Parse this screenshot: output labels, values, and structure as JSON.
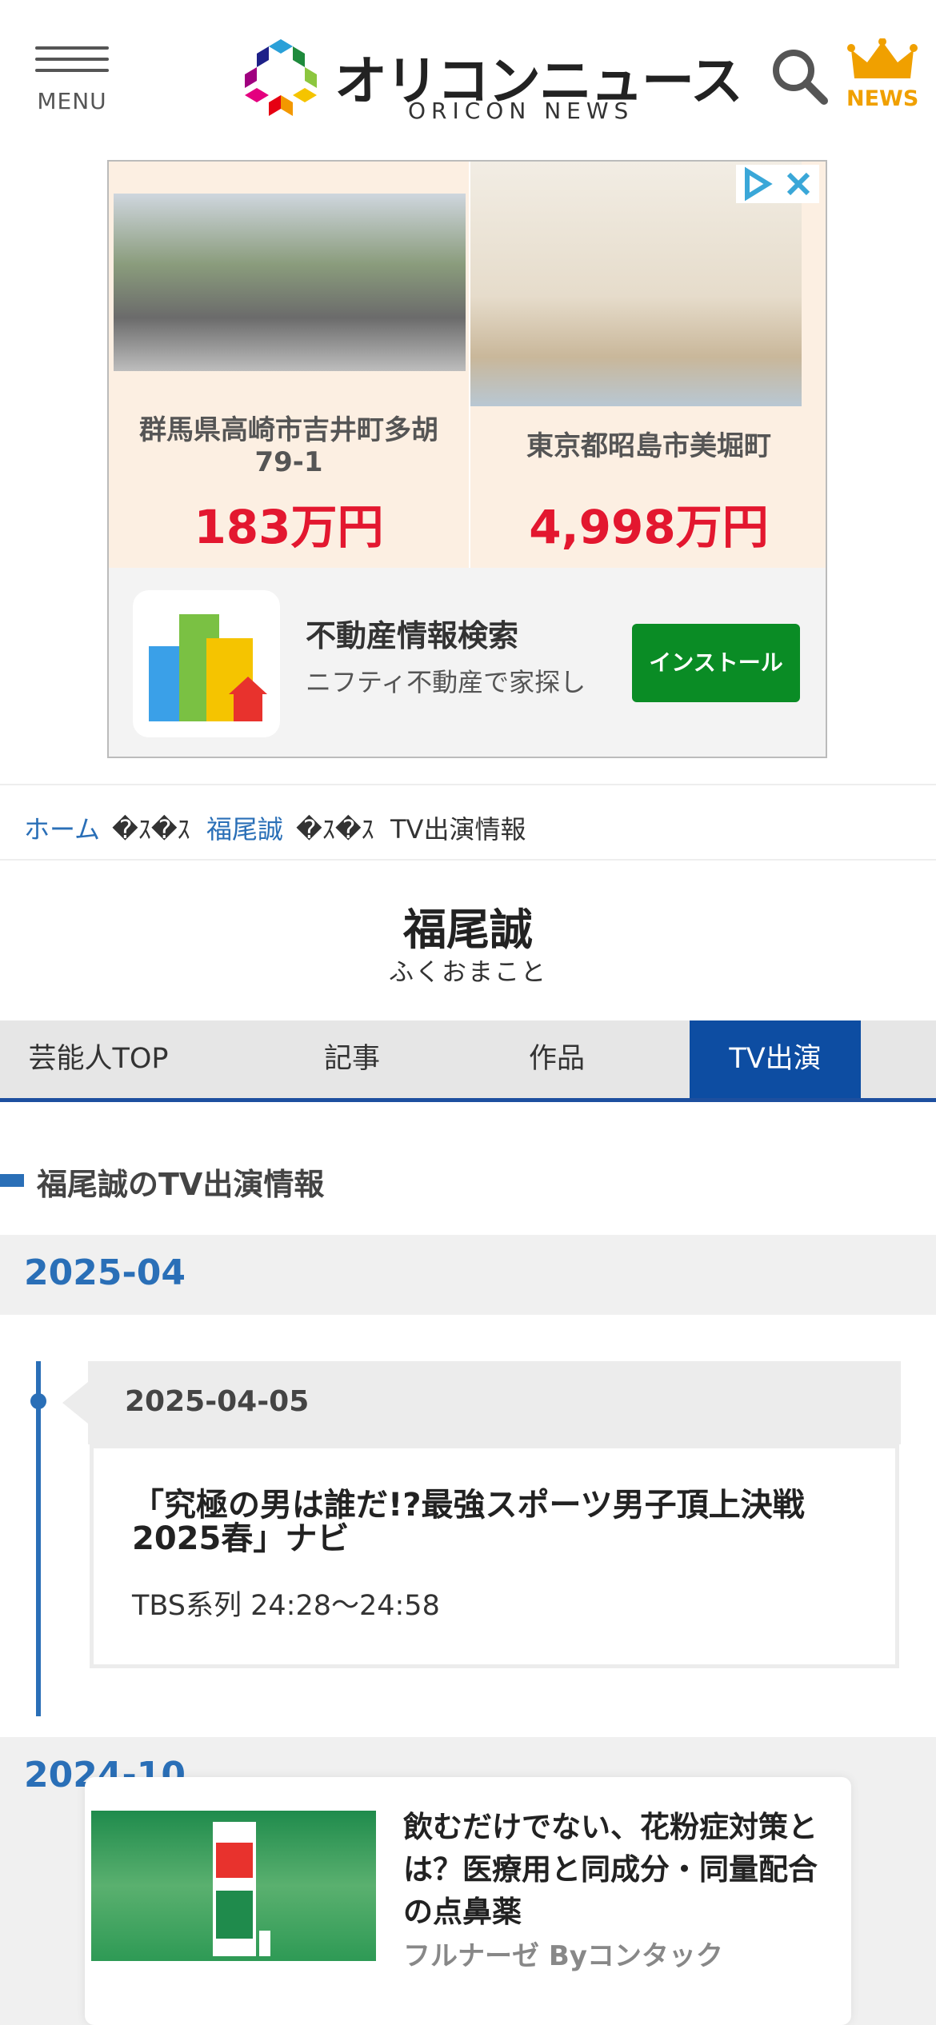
{
  "header": {
    "menu_label": "MENU",
    "logo_title": "オリコンニュース",
    "logo_sub": "ORICON NEWS",
    "news_label": "NEWS"
  },
  "ad": {
    "listings": [
      {
        "location": "群馬県高崎市吉井町多胡79-1",
        "price": "183万円"
      },
      {
        "location": "東京都昭島市美堀町",
        "price": "4,998万円"
      }
    ],
    "app_title": "不動産情報検索",
    "app_desc": "ニフティ不動産で家探し",
    "install_label": "インストール"
  },
  "breadcrumb": {
    "home": "ホーム",
    "separator": "�ｽ�ｽ",
    "person": "福尾誠",
    "current": "TV出演情報"
  },
  "profile": {
    "name": "福尾誠",
    "kana": "ふくおまこと"
  },
  "tabs": [
    {
      "label": "芸能人TOP"
    },
    {
      "label": "記事"
    },
    {
      "label": "作品"
    },
    {
      "label": "TV出演"
    }
  ],
  "section_title": "福尾誠のTV出演情報",
  "months": [
    {
      "label": "2025-04",
      "entries": [
        {
          "date": "2025-04-05",
          "title": "「究極の男は誰だ!?最強スポーツ男子頂上決戦2025春」ナビ",
          "channel": "TBS系列 24:28〜24:58"
        }
      ]
    },
    {
      "label": "2024-10"
    }
  ],
  "sticky_ad": {
    "title": "飲むだけでない、花粉症対策とは？医療用と同成分・同量配合の点鼻薬",
    "sponsor": "フルナーゼ Byコンタック"
  },
  "colors": {
    "accent_blue": "#2a6fb7",
    "tab_active": "#0d4da2",
    "price_red": "#e3172f",
    "install_green": "#0a8c25",
    "news_gold": "#f0a000"
  }
}
